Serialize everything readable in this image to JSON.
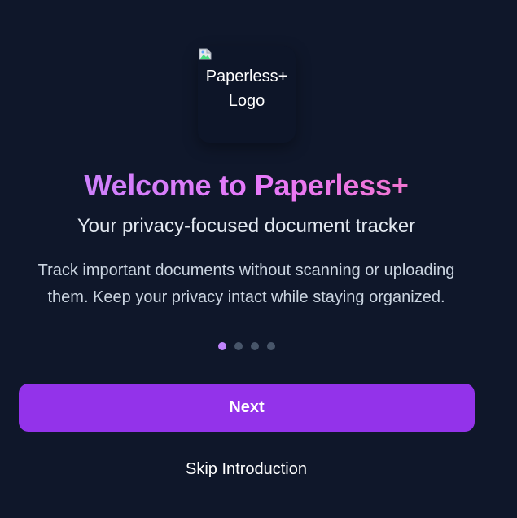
{
  "logo": {
    "alt_text": "Paperless+\nLogo",
    "broken_image_icon": "broken-image-icon"
  },
  "welcome": {
    "title": "Welcome to Paperless+",
    "subtitle": "Your privacy-focused document tracker",
    "description": "Track important documents without scanning or uploading them. Keep your privacy intact while staying organized."
  },
  "pagination": {
    "total": 4,
    "current": 1
  },
  "actions": {
    "next_label": "Next",
    "skip_label": "Skip Introduction"
  },
  "colors": {
    "background": "#0f172a",
    "accent": "#9333ea",
    "title_gradient_start": "#c084fc",
    "title_gradient_end": "#f472b6",
    "dot_active": "#c084fc",
    "dot_inactive": "#475569"
  }
}
